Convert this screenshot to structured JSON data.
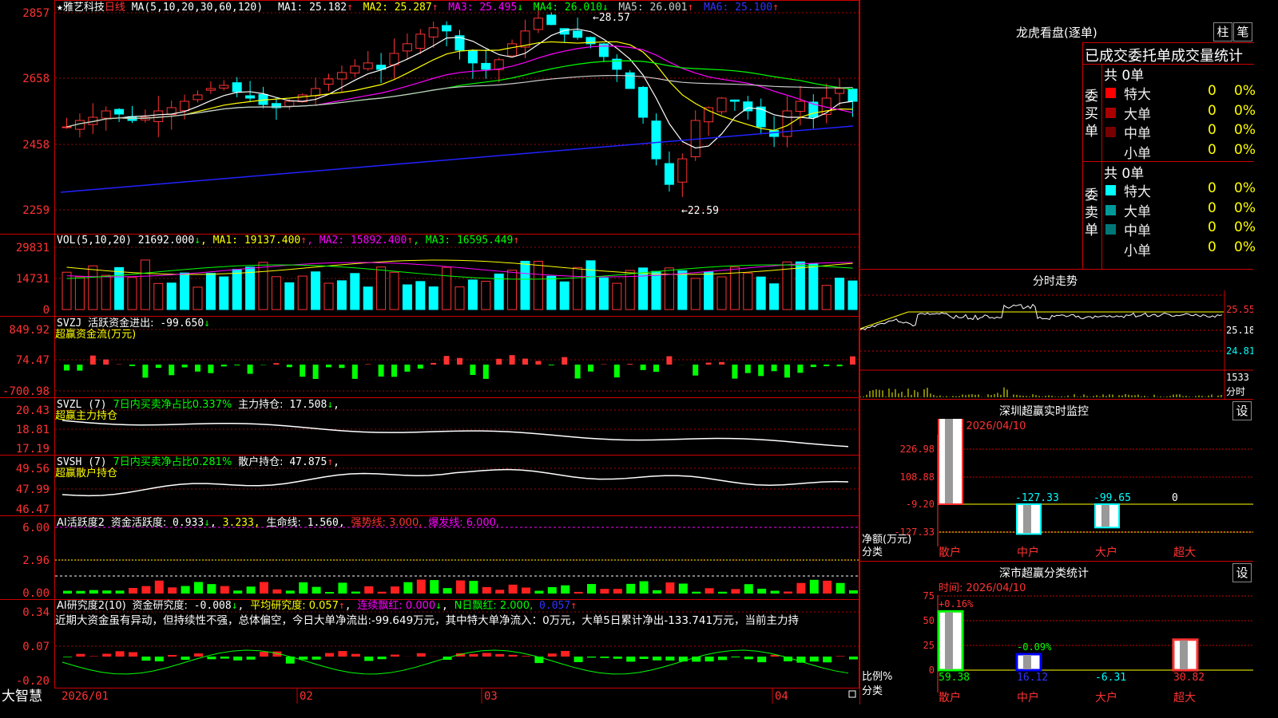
{
  "stock": {
    "star": "★",
    "name": "雅艺科技",
    "period": "日线"
  },
  "colors": {
    "up": "#ff3232",
    "down": "#00ffff",
    "yellow": "#ffff00",
    "magenta": "#ff00ff",
    "green": "#00ff00",
    "white": "#ffffff",
    "blue": "#0000ff",
    "grid": "#aa0000"
  },
  "kline": {
    "ma_label": "MA(5,10,20,30,60,120)",
    "ma_values": [
      {
        "label": "MA1:",
        "value": "25.182",
        "arrow": "↑",
        "color": "#ffffff"
      },
      {
        "label": "MA2:",
        "value": "25.287",
        "arrow": "↑",
        "color": "#ffff00"
      },
      {
        "label": "MA3:",
        "value": "25.495",
        "arrow": "↓",
        "color": "#ff00ff"
      },
      {
        "label": "MA4:",
        "value": "26.010",
        "arrow": "↓",
        "color": "#00ff00"
      },
      {
        "label": "MA5:",
        "value": "26.001",
        "arrow": "↑",
        "color": "#cccccc"
      },
      {
        "label": "MA6:",
        "value": "25.100",
        "arrow": "↑",
        "color": "#3333ff"
      }
    ],
    "y_ticks": [
      "2857",
      "2658",
      "2458",
      "2259"
    ],
    "high_label": "28.57",
    "low_label": "22.59"
  },
  "vol": {
    "label": "VOL(5,10,20)",
    "value": "21692.000",
    "arrow": "↓",
    "mas": [
      {
        "t": "MA1: 19137.400",
        "a": "↑",
        "c": "#ffff00"
      },
      {
        "t": "MA2: 15892.400",
        "a": "↑",
        "c": "#ff00ff"
      },
      {
        "t": "MA3: 16595.449",
        "a": "↑",
        "c": "#00ff00"
      }
    ],
    "y_ticks": [
      "29831",
      "14731",
      "0"
    ]
  },
  "svzj": {
    "label": "SVZJ",
    "desc": "活跃资金进出:",
    "value": "-99.650",
    "arrow": "↓",
    "sub": "超赢资金流(万元)",
    "y_ticks": [
      "849.92",
      "74.47",
      "-700.98"
    ]
  },
  "svzl": {
    "label": "SVZL (7)",
    "desc": "7日内买卖净占比0.337%",
    "desc2": "主力持仓:",
    "value": "17.508",
    "arrow": "↓",
    "sub": "超赢主力持仓",
    "y_ticks": [
      "20.43",
      "18.81",
      "17.19"
    ]
  },
  "svsh": {
    "label": "SVSH (7)",
    "desc": "7日内买卖净占比0.281%",
    "desc2": "散户持仓:",
    "value": "47.875",
    "arrow": "↑",
    "sub": "超赢散户持仓",
    "y_ticks": [
      "49.56",
      "47.99",
      "46.47"
    ]
  },
  "ai1": {
    "label": "AI活跃度2",
    "desc": "资金活跃度:",
    "v1": "0.933",
    "a1": "↓",
    "v2": "3.233,",
    "desc3": "生命线:",
    "v3": "1.560,",
    "strong": "强势线: 3.000,",
    "burst": "爆发线: 6.000,",
    "y_ticks": [
      "6.00",
      "2.96",
      "0.00"
    ]
  },
  "ai2": {
    "label": "AI研究度2(10)",
    "desc": "资金研究度:",
    "v1": "-0.008",
    "a1": "↓",
    "avg": "平均研究度: 0.057",
    "a2": "↑",
    "red": "连续飘红: 0.000",
    "a3": "↓",
    "nred": "N日飘红: 2.000,",
    "v4": "0.057",
    "a4": "↑",
    "comment": "近期大资金虽有异动，但持续性不强，总体偏空，今日大单净流出:-99.649万元，其中特大单净流入：0万元，大单5日累计净出-133.741万元，当前主力持",
    "y_ticks": [
      "0.34",
      "0.07",
      "-0.20"
    ]
  },
  "xaxis": {
    "labels": [
      "2026/01",
      "02",
      "03",
      "04"
    ],
    "brand": "大智慧"
  },
  "lhb": {
    "title": "龙虎看盘(逐单)",
    "btn1": "柱",
    "btn2": "笔",
    "tabs": "已成交委托单成交量统计",
    "buy": {
      "side": [
        "委",
        "买",
        "单"
      ],
      "total": "共 0单",
      "rows": [
        {
          "n": "特大",
          "v": "0",
          "p": "0%",
          "c": "#ff0000"
        },
        {
          "n": "大单",
          "v": "0",
          "p": "0%",
          "c": "#aa0000"
        },
        {
          "n": "中单",
          "v": "0",
          "p": "0%",
          "c": "#770000"
        },
        {
          "n": "小单",
          "v": "0",
          "p": "0%",
          "c": "#000000"
        }
      ]
    },
    "sell": {
      "side": [
        "委",
        "卖",
        "单"
      ],
      "total": "共 0单",
      "rows": [
        {
          "n": "特大",
          "v": "0",
          "p": "0%",
          "c": "#00ffff"
        },
        {
          "n": "大单",
          "v": "0",
          "p": "0%",
          "c": "#009999"
        },
        {
          "n": "中单",
          "v": "0",
          "p": "0%",
          "c": "#007777"
        },
        {
          "n": "小单",
          "v": "0",
          "p": "0%",
          "c": "#000000"
        }
      ]
    }
  },
  "fenshi": {
    "title": "分时走势",
    "ticks": [
      "25.55",
      "25.18",
      "24.81",
      "1533"
    ],
    "unit": "分时"
  },
  "monitor": {
    "title": "深圳超赢实时监控",
    "btn": "设",
    "time": "时间: 2026/04/10",
    "y_ticks": [
      "226.98",
      "108.88",
      "-9.20",
      "-127.33"
    ],
    "ylabel": "净额(万元)",
    "xlabel": "分类",
    "cats": [
      "散户",
      "中户",
      "大户",
      "超大"
    ],
    "values": [
      "226.98",
      "-127.33",
      "-99.65",
      "0"
    ]
  },
  "classify": {
    "title": "深市超赢分类统计",
    "btn": "设",
    "time": "时间: 2026/04/10",
    "y_ticks": [
      "75",
      "50",
      "25",
      "0"
    ],
    "ylabel": "比例%",
    "xlabel": "分类",
    "cats": [
      "散户",
      "中户",
      "大户",
      "超大"
    ],
    "bars": [
      "59.38",
      "16.12",
      "-6.31",
      "30.82"
    ],
    "top_labels": [
      "+0.16%",
      "-0.09%"
    ]
  }
}
